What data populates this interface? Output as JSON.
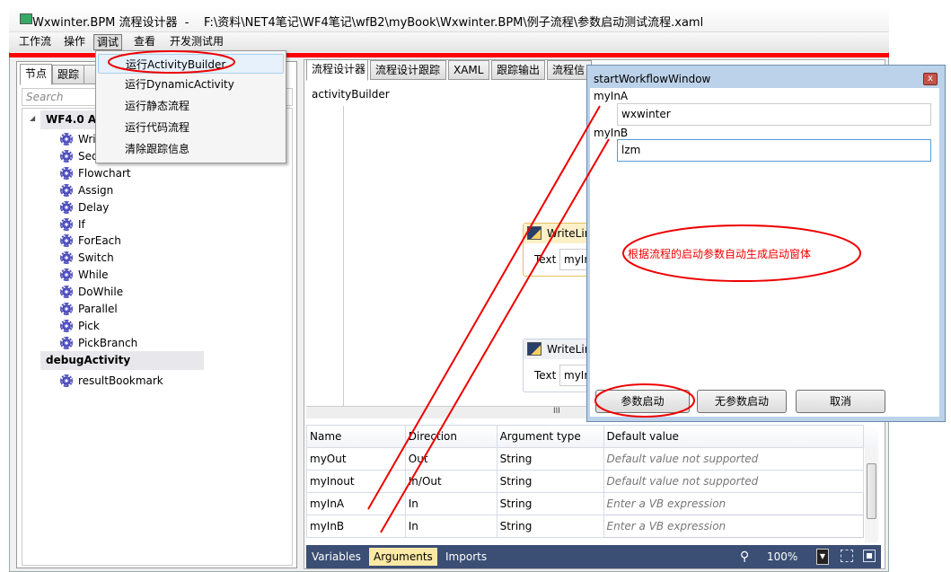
{
  "window": {
    "title": "Wxwinter.BPM 流程设计器  -    F:\\资料\\NET4笔记\\WF4笔记\\wfB2\\myBook\\Wxwinter.BPM\\例子流程\\参数启动测试流程.xaml"
  },
  "menu": [
    "工作流",
    "操作",
    "调试",
    "查看",
    "开发测试用"
  ],
  "debug_menu": [
    "运行ActivityBuilder",
    "运行DynamicActivity",
    "运行静态流程",
    "运行代码流程",
    "清除跟踪信息"
  ],
  "left_tabs": [
    "节点",
    "跟踪"
  ],
  "search_placeholder": "Search",
  "toolbox": {
    "group1": "WF4.0 Ac",
    "items": [
      "Wri",
      "Seq",
      "Flowchart",
      "Assign",
      "Delay",
      "If",
      "ForEach",
      "Switch",
      "While",
      "DoWhile",
      "Parallel",
      "Pick",
      "PickBranch"
    ],
    "group2": "debugActivity",
    "items2": [
      "resultBookmark"
    ]
  },
  "designer_tabs": [
    "流程设计器",
    "流程设计跟踪",
    "XAML",
    "跟踪输出",
    "流程信"
  ],
  "breadcrumb": "activityBuilder",
  "activities": [
    {
      "title": "WriteLin",
      "label": "Text",
      "value": "myIn"
    },
    {
      "title": "WriteLin",
      "label": "Text",
      "value": "myIn"
    }
  ],
  "scroll_grip": "III",
  "arguments": {
    "headers": [
      "Name",
      "Direction",
      "Argument type",
      "Default value"
    ],
    "rows": [
      [
        "myOut",
        "Out",
        "String",
        "Default value not supported"
      ],
      [
        "myInout",
        "In/Out",
        "String",
        "Default value not supported"
      ],
      [
        "myInA",
        "In",
        "String",
        "Enter a VB expression"
      ],
      [
        "myInB",
        "In",
        "String",
        "Enter a VB expression"
      ]
    ]
  },
  "bottom_tabs": [
    "Variables",
    "Arguments",
    "Imports"
  ],
  "zoom": "100%",
  "dialog": {
    "title": "startWorkflowWindow",
    "fields": [
      {
        "label": "myInA",
        "value": "wxwinter"
      },
      {
        "label": "myInB",
        "value": "lzm"
      }
    ],
    "buttons": [
      "参数启动",
      "无参数启动",
      "取消"
    ],
    "close": "x"
  },
  "annotation": "根据流程的启动参数自动生成启动窗体"
}
